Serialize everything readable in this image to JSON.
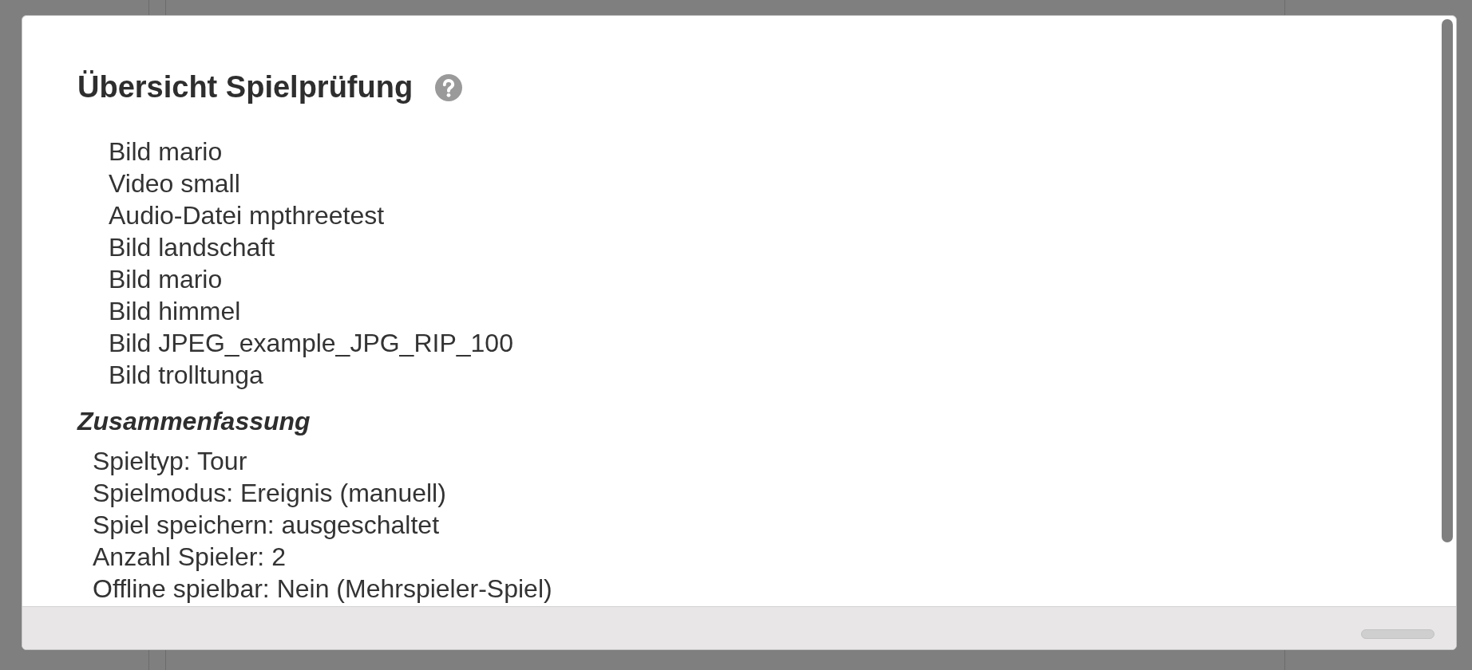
{
  "dialog": {
    "title": "Übersicht Spielprüfung",
    "items": [
      "Bild mario",
      "Video small",
      "Audio-Datei mpthreetest",
      "Bild landschaft",
      "Bild mario",
      "Bild himmel",
      "Bild JPEG_example_JPG_RIP_100",
      "Bild trolltunga"
    ],
    "summary": {
      "heading": "Zusammenfassung",
      "lines": [
        "Spieltyp: Tour",
        "Spielmodus: Ereignis (manuell)",
        "Spiel speichern: ausgeschaltet",
        "Anzahl Spieler: 2",
        "Offline spielbar: Nein (Mehrspieler-Spiel)"
      ]
    }
  }
}
